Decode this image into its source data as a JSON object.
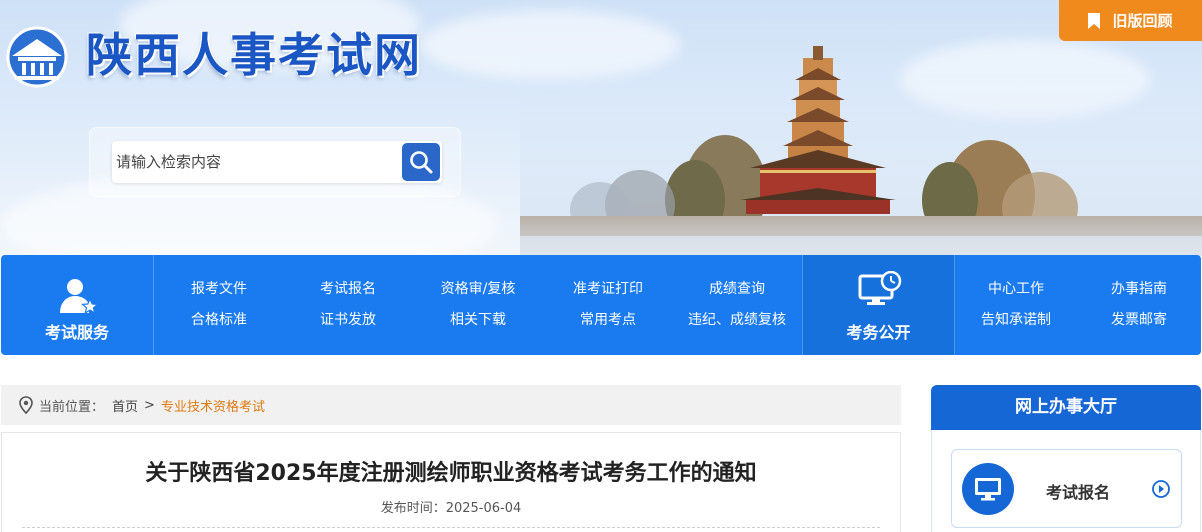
{
  "header": {
    "site_title": "陕西人事考试网",
    "old_version_label": "旧版回顾",
    "search_placeholder": "请输入检索内容"
  },
  "nav": {
    "exam_service_label": "考试服务",
    "exam_public_label": "考务公开",
    "service_links": [
      [
        "报考文件",
        "考试报名",
        "资格审/复核",
        "准考证打印",
        "成绩查询"
      ],
      [
        "合格标准",
        "证书发放",
        "相关下载",
        "常用考点",
        "违纪、成绩复核"
      ]
    ],
    "public_links": [
      [
        "中心工作",
        "办事指南"
      ],
      [
        "告知承诺制",
        "发票邮寄"
      ]
    ]
  },
  "breadcrumb": {
    "label": "当前位置：",
    "home": "首页",
    "separator": ">",
    "current": "专业技术资格考试"
  },
  "article": {
    "title": "关于陕西省2025年度注册测绘师职业资格考试考务工作的通知",
    "publish_label": "发布时间：",
    "publish_date": "2025-06-04"
  },
  "sidebar": {
    "heading": "网上办事大厅",
    "card_label": "考试报名"
  },
  "colors": {
    "brand_blue": "#1a7bf0",
    "title_blue": "#1a56c4",
    "accent_orange": "#f08a1c",
    "breadcrumb_current": "#e07a12"
  }
}
